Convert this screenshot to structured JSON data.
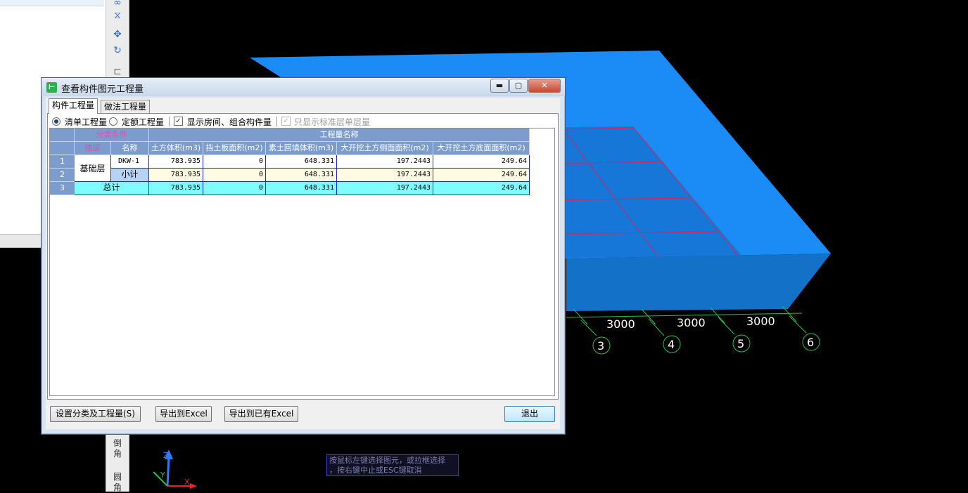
{
  "dialog": {
    "title": "查看构件图元工程量",
    "title_icon": "app-icon",
    "minimize": "▬",
    "maximize": "▢",
    "close": "✕"
  },
  "tabs": [
    "构件工程量",
    "做法工程量"
  ],
  "options": {
    "radio1": "清单工程量",
    "radio2": "定额工程量",
    "check1": "显示房间、组合构件量",
    "check2": "只显示标准层单层量",
    "radio1_selected": true,
    "check1_checked": true,
    "check2_checked": true,
    "check2_disabled": true
  },
  "table": {
    "group_left": "分类条件",
    "group_right": "工程量名称",
    "col_floor": "楼层",
    "col_name": "名称",
    "columns": [
      "土方体积(m3)",
      "挡土板面积(m2)",
      "素土回填体积(m3)",
      "大开挖土方侧面面积(m2)",
      "大开挖土方底面面积(m2)"
    ],
    "rows": [
      {
        "no": "1",
        "floor": "基础层",
        "name": "DKW-1",
        "values": [
          "783.935",
          "0",
          "648.331",
          "197.2443",
          "249.64"
        ]
      },
      {
        "no": "2",
        "floor": "",
        "name": "小计",
        "values": [
          "783.935",
          "0",
          "648.331",
          "197.2443",
          "249.64"
        ]
      },
      {
        "no": "3",
        "floor": "",
        "name": "总计",
        "values": [
          "783.935",
          "0",
          "648.331",
          "197.2443",
          "249.64"
        ]
      }
    ]
  },
  "buttons": {
    "settings": "设置分类及工程量(S)",
    "export_excel": "导出到Excel",
    "export_existing": "导出到已有Excel",
    "exit": "退出"
  },
  "scene": {
    "dims": [
      "3000",
      "3000",
      "3000"
    ],
    "axis_numbers": [
      "3",
      "4",
      "5",
      "6"
    ],
    "axes": {
      "z": "Z",
      "y": "Y",
      "x": "X"
    },
    "colors": {
      "box_top": "#1b8cf5",
      "box_front": "#1471c8",
      "box_side": "#0f66b8",
      "grid_line": "#d6245a",
      "axis_green": "#22c24a"
    }
  },
  "toolbar": {
    "label_chamfer": "倒角",
    "label_fillet": "圆角"
  },
  "status": {
    "line1": "按鼠标左键选择图元，或拉框选择",
    "line2": "，按右键中止或ESC键取消"
  }
}
